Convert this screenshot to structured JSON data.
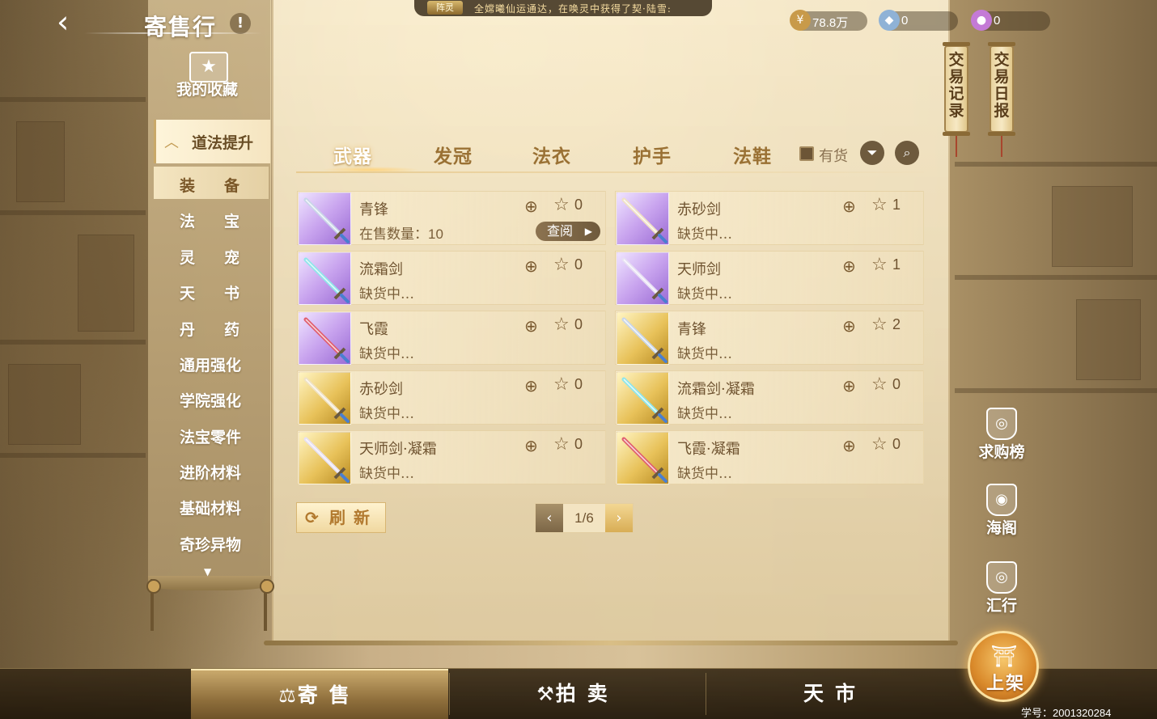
{
  "header": {
    "back_icon": "chevron-left-icon",
    "title": "寄售行",
    "info_icon": "exclamation-icon",
    "info_mark": "!"
  },
  "ticker": {
    "badge": "阵灵",
    "text": "全嫦曦仙运通达，在唤灵中获得了契·陆雪:"
  },
  "currencies": [
    {
      "icon": "gold-coin-icon",
      "value": "78.8万"
    },
    {
      "icon": "silver-ingot-icon",
      "value": "0"
    },
    {
      "icon": "spirit-gem-icon",
      "value": "0"
    }
  ],
  "scroll_buttons": [
    {
      "label": "交易记录"
    },
    {
      "label": "交易日报"
    }
  ],
  "sidebar": {
    "favorites_label": "我的收藏",
    "category": "道法提升",
    "items": [
      {
        "label": "装备",
        "active": true
      },
      {
        "label": "法宝",
        "active": false
      },
      {
        "label": "灵宠",
        "active": false
      },
      {
        "label": "天书",
        "active": false
      },
      {
        "label": "丹药",
        "active": false
      },
      {
        "label": "通用强化",
        "active": false
      },
      {
        "label": "学院强化",
        "active": false
      },
      {
        "label": "法宝零件",
        "active": false
      },
      {
        "label": "进阶材料",
        "active": false
      },
      {
        "label": "基础材料",
        "active": false
      },
      {
        "label": "奇珍异物",
        "active": false
      }
    ]
  },
  "tabs": [
    {
      "label": "武器",
      "active": true
    },
    {
      "label": "发冠",
      "active": false
    },
    {
      "label": "法衣",
      "active": false
    },
    {
      "label": "护手",
      "active": false
    },
    {
      "label": "法鞋",
      "active": false
    }
  ],
  "filters": {
    "in_stock_label": "有货",
    "in_stock_checked": false
  },
  "items": [
    {
      "name": "青锋",
      "status": "在售数量：",
      "count": "10",
      "stars": "0",
      "rarity": "purple",
      "view_label": "查阅",
      "blade": "#c9d6e8"
    },
    {
      "name": "赤砂剑",
      "status": "缺货中…",
      "stars": "1",
      "rarity": "purple",
      "blade": "#f0e2c4"
    },
    {
      "name": "流霜剑",
      "status": "缺货中…",
      "stars": "0",
      "rarity": "purple",
      "blade": "#8fe6ea"
    },
    {
      "name": "天师剑",
      "status": "缺货中…",
      "stars": "1",
      "rarity": "purple",
      "blade": "#e7e0f3"
    },
    {
      "name": "飞霞",
      "status": "缺货中…",
      "stars": "0",
      "rarity": "purple",
      "blade": "#e06070"
    },
    {
      "name": "青锋",
      "status": "缺货中…",
      "stars": "2",
      "rarity": "gold",
      "blade": "#c9d6e8"
    },
    {
      "name": "赤砂剑",
      "status": "缺货中…",
      "stars": "0",
      "rarity": "gold",
      "blade": "#f0e2c4"
    },
    {
      "name": "流霜剑·凝霜",
      "status": "缺货中…",
      "stars": "0",
      "rarity": "gold",
      "blade": "#8fe6ea"
    },
    {
      "name": "天师剑·凝霜",
      "status": "缺货中…",
      "stars": "0",
      "rarity": "gold",
      "blade": "#e7e0f3"
    },
    {
      "name": "飞霞·凝霜",
      "status": "缺货中…",
      "stars": "0",
      "rarity": "gold",
      "blade": "#e06070"
    }
  ],
  "refresh_label": "刷新",
  "pagination": {
    "current": "1/6"
  },
  "right_nav": [
    {
      "label": "求购榜",
      "icon": "purchase-ranking-icon"
    },
    {
      "label": "海阁",
      "icon": "sea-pavilion-icon"
    },
    {
      "label": "汇行",
      "icon": "exchange-house-icon"
    }
  ],
  "bottom_nav": [
    {
      "label": "寄售",
      "icon": "scale-icon",
      "active": true
    },
    {
      "label": "拍卖",
      "icon": "gavel-icon",
      "active": false
    },
    {
      "label": "天市",
      "icon": "",
      "active": false
    }
  ],
  "list_button_label": "上架",
  "student_id": "学号：2001320284",
  "colors": {
    "purple_rarity": "#b28ae0",
    "gold_rarity": "#e0b440",
    "accent_text": "#9a7134"
  }
}
